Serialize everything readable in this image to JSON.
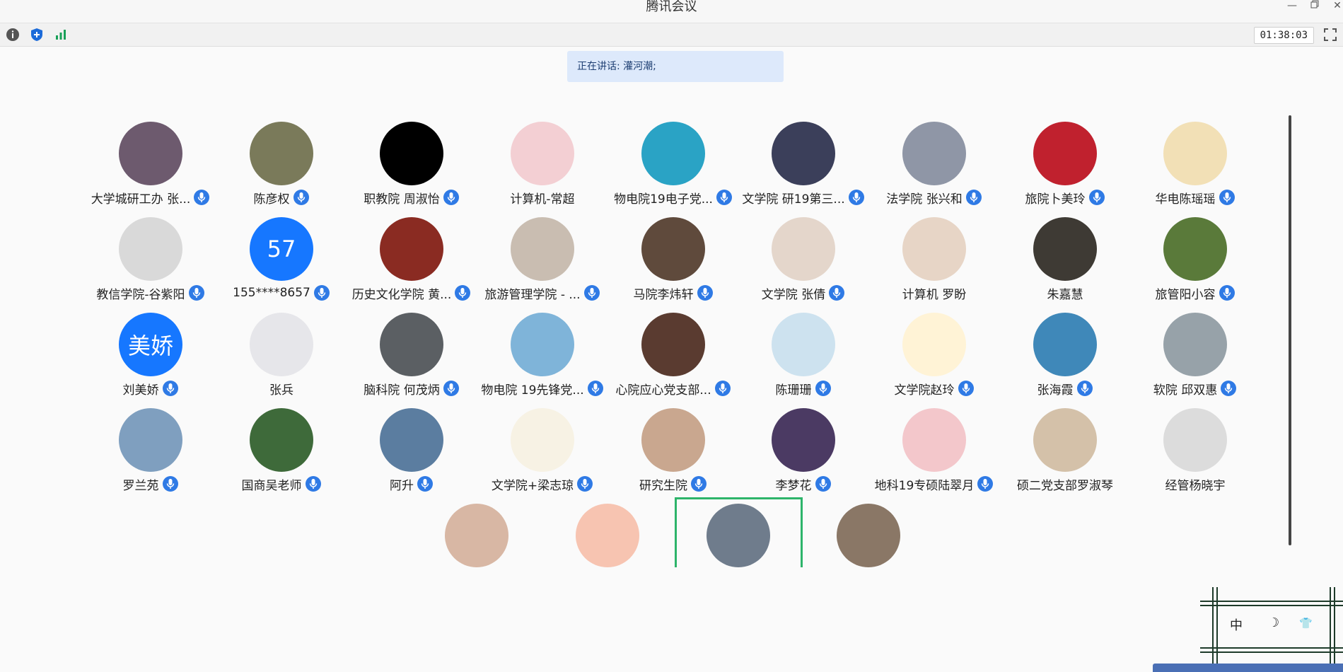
{
  "window": {
    "title": "腾讯会议"
  },
  "toolbar": {
    "timer": "01:38:03"
  },
  "speaking": {
    "label": "正在讲话: 灌河潮;"
  },
  "widget": {
    "chars": [
      "中",
      "☽",
      "👕"
    ]
  },
  "colors": {
    "accent": "#2f7ae5",
    "speaking_bg": "#dde9fb",
    "highlight": "#2db46a"
  },
  "participants": [
    {
      "name": "大学城研工办 张...",
      "mic": true,
      "bg": "#6d5a6e"
    },
    {
      "name": "陈彦权",
      "mic": true,
      "bg": "#7a7a5a"
    },
    {
      "name": "职教院 周淑怡",
      "mic": true,
      "bg": "#000000"
    },
    {
      "name": "计算机-常超",
      "mic": false,
      "bg": "#f3cfd3"
    },
    {
      "name": "物电院19电子党...",
      "mic": true,
      "bg": "#2aa3c5"
    },
    {
      "name": "文学院 研19第三...",
      "mic": true,
      "bg": "#3b3f5a"
    },
    {
      "name": "法学院 张兴和",
      "mic": true,
      "bg": "#8f96a6"
    },
    {
      "name": "旅院卜美玲",
      "mic": true,
      "bg": "#c0212e"
    },
    {
      "name": "华电陈瑶瑶",
      "mic": true,
      "bg": "#f2e0b6"
    },
    {
      "name": "教信学院-谷紫阳",
      "mic": true,
      "bg": "#d9d9d9"
    },
    {
      "name": "155****8657",
      "mic": true,
      "bg": "#1677ff",
      "avatar_text": "57"
    },
    {
      "name": "历史文化学院 黄...",
      "mic": true,
      "bg": "#8a2b22"
    },
    {
      "name": "旅游管理学院 - ...",
      "mic": true,
      "bg": "#c9bdb1"
    },
    {
      "name": "马院李炜轩",
      "mic": true,
      "bg": "#5f4a3c"
    },
    {
      "name": "文学院 张倩",
      "mic": true,
      "bg": "#e4d6cb"
    },
    {
      "name": "计算机 罗盼",
      "mic": false,
      "bg": "#e7d5c6"
    },
    {
      "name": "朱嘉慧",
      "mic": false,
      "bg": "#3e3a34"
    },
    {
      "name": "旅管阳小容",
      "mic": true,
      "bg": "#5a7a3a"
    },
    {
      "name": "刘美娇",
      "mic": true,
      "bg": "#1677ff",
      "avatar_text": "美娇"
    },
    {
      "name": "张兵",
      "mic": false,
      "bg": "#e6e6ea"
    },
    {
      "name": "脑科院 何茂炳",
      "mic": true,
      "bg": "#5b5f63"
    },
    {
      "name": "物电院 19先锋党...",
      "mic": true,
      "bg": "#7fb4d9"
    },
    {
      "name": "心院应心党支部...",
      "mic": true,
      "bg": "#5a3b30"
    },
    {
      "name": "陈珊珊",
      "mic": true,
      "bg": "#cde2ef"
    },
    {
      "name": "文学院赵玲",
      "mic": true,
      "bg": "#fff3d6"
    },
    {
      "name": "张海霞",
      "mic": true,
      "bg": "#3f88b9"
    },
    {
      "name": "软院 邱双惠",
      "mic": true,
      "bg": "#97a2a9"
    },
    {
      "name": "罗兰苑",
      "mic": true,
      "bg": "#7f9fbf"
    },
    {
      "name": "国商吴老师",
      "mic": true,
      "bg": "#3e6a3a"
    },
    {
      "name": "阿升",
      "mic": true,
      "bg": "#5b7da0"
    },
    {
      "name": "文学院+梁志琼",
      "mic": true,
      "bg": "#f7f2e4"
    },
    {
      "name": "研究生院",
      "mic": true,
      "bg": "#c9a78f"
    },
    {
      "name": "李梦花",
      "mic": true,
      "bg": "#4b3a63"
    },
    {
      "name": "地科19专硕陆翠月",
      "mic": true,
      "bg": "#f3c7cb"
    },
    {
      "name": "硕二党支部罗淑琴",
      "mic": false,
      "bg": "#d4c1a9"
    },
    {
      "name": "经管杨晓宇",
      "mic": false,
      "bg": "#dcdcdc"
    },
    {
      "name": "",
      "mic": false,
      "bg": "#d8b7a4"
    },
    {
      "name": "",
      "mic": false,
      "bg": "#f7c4b1"
    },
    {
      "name": "",
      "mic": false,
      "bg": "#6f7c8c"
    },
    {
      "name": "",
      "mic": false,
      "bg": "#8a7766"
    }
  ]
}
